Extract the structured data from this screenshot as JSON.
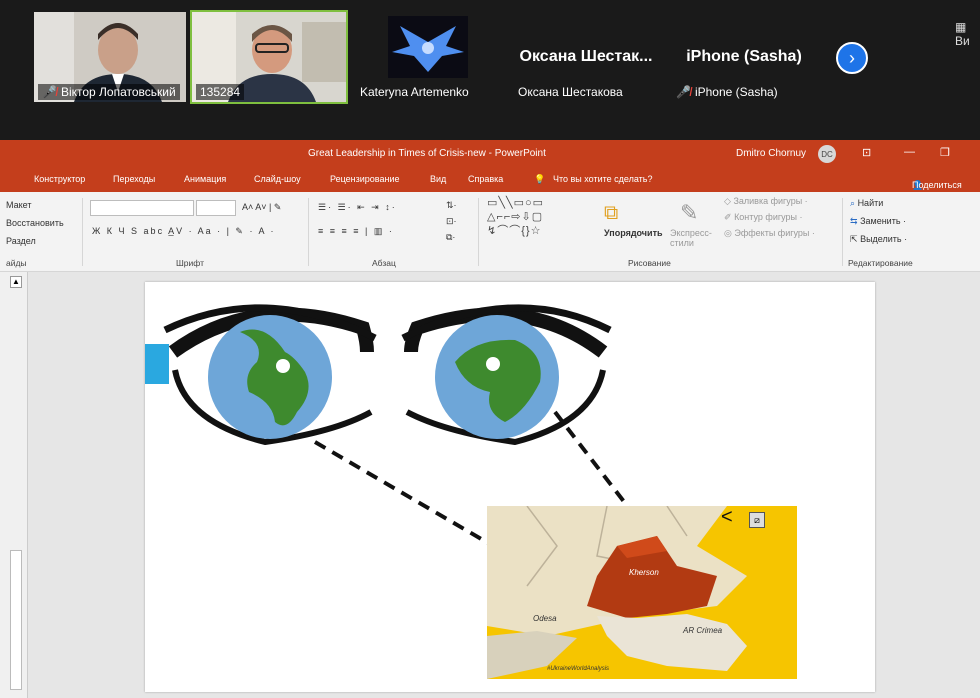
{
  "zoom": {
    "participants": [
      {
        "name": "Віктор Лопатовський",
        "muted": true
      },
      {
        "name": "135284",
        "muted": false
      },
      {
        "name": "Kateryna Artemenko",
        "muted": false
      },
      {
        "name": "Оксана Шестакова",
        "display": "Оксана Шестак...",
        "muted": false
      },
      {
        "name": "iPhone (Sasha)",
        "display": "iPhone (Sasha)",
        "muted": true
      }
    ],
    "view_label": "Ви"
  },
  "powerpoint": {
    "title": "Great Leadership in Times of Crisis-new  -  PowerPoint",
    "user": "Dmitro Chornuy",
    "user_initials": "DC",
    "tabs": [
      "Конструктор",
      "Переходы",
      "Анимация",
      "Слайд-шоу",
      "Рецензирование",
      "Вид",
      "Справка",
      "Что вы хотите сделать?"
    ],
    "share": "Поделиться",
    "ribbon": {
      "slides_items": [
        "Макет",
        "Восстановить",
        "Раздел",
        "айды"
      ],
      "font_group": "Шрифт",
      "paragraph_group": "Абзац",
      "drawing_group": "Рисование",
      "arrange": "Упорядочить",
      "express": "Экспресс-стили",
      "fill": "Заливка фигуры",
      "outline": "Контур фигуры",
      "effects": "Эффекты фигуры",
      "edit_group": "Редактирование",
      "find": "Найти",
      "replace": "Заменить",
      "select": "Выделить"
    },
    "map_labels": {
      "kherson": "Kherson",
      "ar_crimea": "AR Crimea",
      "odesa": "Odesa",
      "hashtag": "#UkraineWorldAnalysis"
    }
  }
}
